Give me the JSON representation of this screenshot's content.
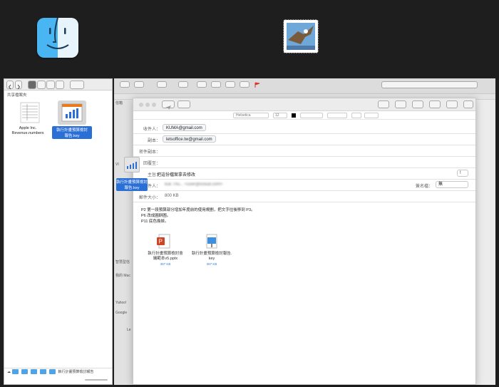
{
  "finder": {
    "sidebar_header": "共享檔案夾",
    "files": [
      {
        "name": "Apple Inc. Revenue.numbers",
        "line1": "Apple Inc.",
        "line2": "Revenue.numbers"
      },
      {
        "name": "執行計畫預算檢討報告.key",
        "line1": "執行計畫預算檢討",
        "line2": "報告.key"
      }
    ],
    "breadcrumb_last": "執行計畫預算檢討報告"
  },
  "mail_main": {
    "sidebar_header": "信箱",
    "sidebar_sections": [
      "智慧型信",
      "我的 Mac",
      "Yahoo!",
      "Google"
    ],
    "sidebar_labels": [
      "VI",
      "Le"
    ]
  },
  "drag_ghost": {
    "line1": "執行計畫預算檢討",
    "line2": "報告.key"
  },
  "compose": {
    "font_name": "Helvetica",
    "font_size": "12",
    "to_label": "收件人：",
    "to_value": "KUMA@gmail.com",
    "cc_label": "副本：",
    "cc_value": "letsoffice.tw@gmail.com",
    "bcc_label": "密件副本：",
    "reply_label": "回覆至：",
    "subject_label": "主旨：",
    "subject_value": "把這份檔案拿去修改",
    "from_label": "寄件人：",
    "from_value": "kuk Thu... <user@icloud.com>",
    "signature_label": "簽名檔：",
    "signature_value": "無",
    "size_label": "郵件大小：",
    "size_value": "800 KB",
    "priority_value": "!",
    "body_lines": [
      "P2 第一段預算部分增加年度前的使用規劃，把文字往後移到 P3。",
      "P6 改成圓餅圖。",
      "P11 底色換掉。"
    ],
    "attachments": [
      {
        "name_line1": "執行計畫預算檢討會",
        "name_line2": "議範本v5.pptx",
        "size": "387 KB"
      },
      {
        "name_line1": "執行計畫預算檢討報告.",
        "name_line2": "key",
        "size": "397 KB"
      }
    ]
  },
  "colors": {
    "accent": "#2a6fd6",
    "finder_blue": "#49b5f2",
    "keynote_orange": "#e87b1e",
    "flag_red": "#d33"
  }
}
